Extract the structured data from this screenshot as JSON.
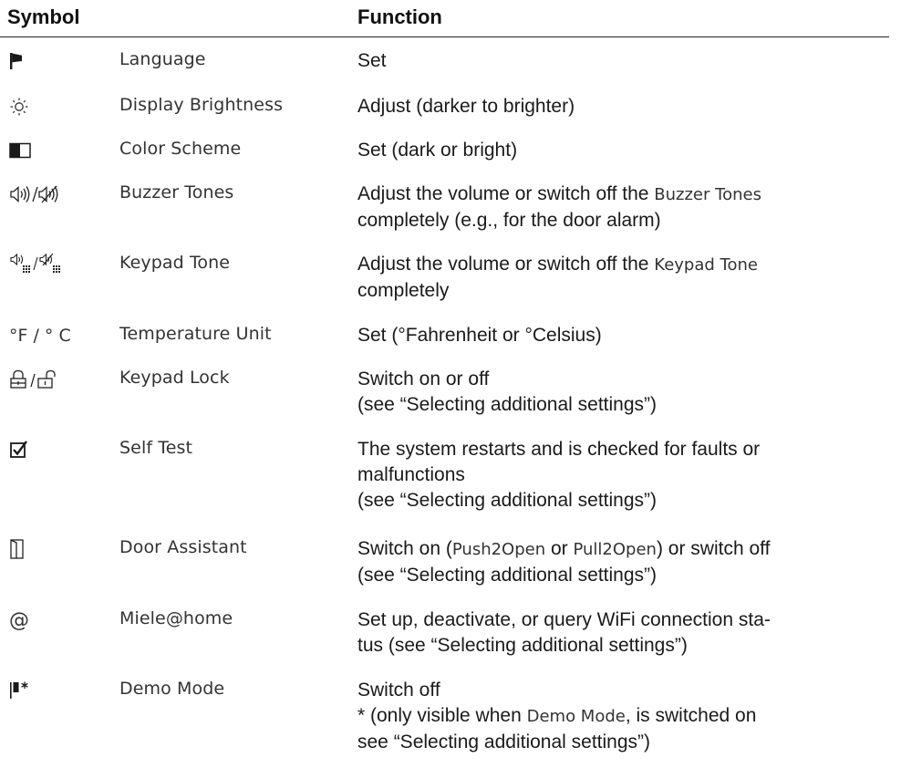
{
  "header": {
    "symbol": "Symbol",
    "function": "Function"
  },
  "rows": [
    {
      "icon": "flag-icon",
      "label": "Language",
      "function": [
        "Set"
      ]
    },
    {
      "icon": "brightness-icon",
      "label": "Display Brightness",
      "function": [
        "Adjust (darker to brighter)"
      ]
    },
    {
      "icon": "color-scheme-icon",
      "label": "Color Scheme",
      "function": [
        "Set (dark or bright)"
      ]
    },
    {
      "icon": "buzzer-tones-icon",
      "label": "Buzzer Tones",
      "function_parts": {
        "a": "Adjust the volume or switch off the ",
        "term": "Buzzer Tones",
        "b": "completely (e.g., for the door alarm)"
      }
    },
    {
      "icon": "keypad-tone-icon",
      "label": "Keypad Tone",
      "function_parts": {
        "a": "Adjust the volume or switch off the ",
        "term": "Keypad Tone",
        "b": "completely"
      }
    },
    {
      "icon": "temperature-unit-icon",
      "symbol_text": "°F / ° C",
      "label": "Temperature Unit",
      "function": [
        "Set (°Fahrenheit or °Celsius)"
      ]
    },
    {
      "icon": "keypad-lock-icon",
      "label": "Keypad Lock",
      "function": [
        "Switch on or off",
        "(see “Selecting additional settings”)"
      ]
    },
    {
      "icon": "self-test-icon",
      "label": "Self Test",
      "function": [
        "The system restarts and is checked for faults or",
        "malfunctions",
        "(see “Selecting additional settings”)"
      ]
    },
    {
      "icon": "door-assistant-icon",
      "label": "Door Assistant",
      "function_parts": {
        "a": "Switch on (",
        "term1": "Push2Open",
        "mid": " or ",
        "term2": "Pull2Open",
        "end": ") or switch off",
        "b": "(see “Selecting additional settings”)"
      }
    },
    {
      "icon": "at-sign-icon",
      "symbol_text": "@",
      "label": "Miele@home",
      "function": [
        "Set up, deactivate, or query WiFi connection sta-",
        "tus (see “Selecting additional settings”)"
      ]
    },
    {
      "icon": "demo-mode-icon",
      "label": "Demo Mode",
      "function_parts": {
        "a": "Switch off",
        "b1": "* (only visible when ",
        "term": "Demo Mode",
        "b2": ", is switched on",
        "c": "see “Selecting additional settings”)"
      }
    }
  ]
}
